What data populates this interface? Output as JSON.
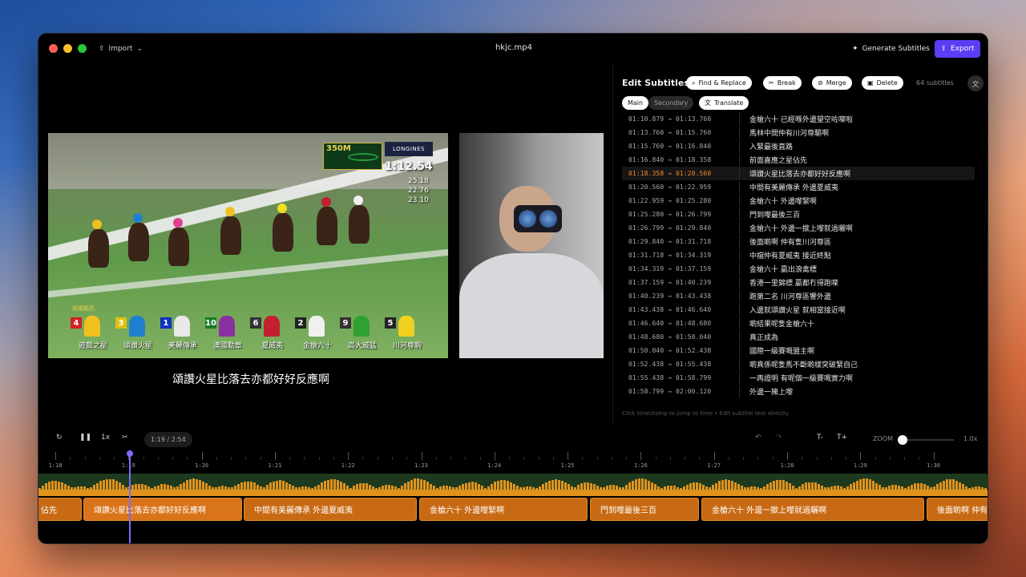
{
  "window": {
    "title": "hkjc.mp4",
    "import_label": "Import",
    "generate_label": "Generate Subtitles",
    "export_label": "Export"
  },
  "video": {
    "distance_badge": "350M",
    "sponsor": "LONGINES",
    "race_time": "1:12.54",
    "splits": [
      "25.18",
      "22.76",
      "23.10"
    ],
    "leader_label": "前領馬匹",
    "runners": [
      {
        "number": "4",
        "name": "遊戲之星",
        "num_color": "#d42020",
        "silk_color": "#f0c020"
      },
      {
        "number": "3",
        "name": "頌讚火星",
        "num_color": "#e0c010",
        "silk_color": "#2080d0"
      },
      {
        "number": "1",
        "name": "美麗傳承",
        "num_color": "#1030c0",
        "silk_color": "#e8e8e8"
      },
      {
        "number": "10",
        "name": "澳國勳章",
        "num_color": "#1a7a2a",
        "silk_color": "#8a30a0"
      },
      {
        "number": "6",
        "name": "夏威夷",
        "num_color": "#333333",
        "silk_color": "#c02030"
      },
      {
        "number": "2",
        "name": "金槍六十",
        "num_color": "#222222",
        "silk_color": "#f0f0f0"
      },
      {
        "number": "9",
        "name": "高大威猛",
        "num_color": "#333333",
        "silk_color": "#30a030"
      },
      {
        "number": "5",
        "name": "川河尊駒",
        "num_color": "#222222",
        "silk_color": "#f0d020"
      }
    ],
    "subtitle": "頌讚火星比落去亦都好好反應啊"
  },
  "editor": {
    "title": "Edit Subtitles",
    "find_replace_label": "Find & Replace",
    "break_label": "Break",
    "merge_label": "Merge",
    "delete_label": "Delete",
    "count_label": "64 subtitles",
    "main_label": "Main",
    "secondary_label": "Secondary",
    "translate_label": "Translate",
    "hint": "Click timestamp to jump to time • Edit subtitle text directly",
    "subtitles": [
      {
        "time": "01:10.879 → 01:13.760",
        "text": "金槍六十  已經喺外邊望空咗㗎啦"
      },
      {
        "time": "01:13.760 → 01:15.760",
        "text": "馬林中間仲有川河尊驅啊"
      },
      {
        "time": "01:15.760 → 01:16.840",
        "text": "入緊最後直路"
      },
      {
        "time": "01:16.840 → 01:18.358",
        "text": "前面嘉應之星佔先"
      },
      {
        "time": "01:18.358 → 01:20.560",
        "text": "頌讚火星比落去亦都好好反應啊",
        "active": true
      },
      {
        "time": "01:20.560 → 01:22.959",
        "text": "中間有美麗傳承  外邊夏威夷"
      },
      {
        "time": "01:22.959 → 01:25.280",
        "text": "金槍六十  外邊嚟緊啊"
      },
      {
        "time": "01:25.280 → 01:26.799",
        "text": "門到嚟最後三百"
      },
      {
        "time": "01:26.799 → 01:29.840",
        "text": "金槍六十  外邊一撳上嚟就過曬啊"
      },
      {
        "time": "01:29.840 → 01:31.718",
        "text": "後面啲啊  仲有隻川河尊區"
      },
      {
        "time": "01:31.718 → 01:34.319",
        "text": "中檔仲有夏威夷  接近終點"
      },
      {
        "time": "01:34.319 → 01:37.159",
        "text": "金槍六十  贏出浪禽標"
      },
      {
        "time": "01:37.159 → 01:40.239",
        "text": "香港一里錦標  贏都冇得跑㗎"
      },
      {
        "time": "01:40.239 → 01:43.438",
        "text": "跑第二名  川河尊區響外邊"
      },
      {
        "time": "01:43.438 → 01:46.640",
        "text": "入邊就頌讚火星  就相當接近啊"
      },
      {
        "time": "01:46.640 → 01:48.680",
        "text": "啲結果呢隻金槍六十"
      },
      {
        "time": "01:48.680 → 01:50.040",
        "text": "真正成為"
      },
      {
        "time": "01:50.040 → 01:52.438",
        "text": "國際一級賽嘅盟主啊"
      },
      {
        "time": "01:52.438 → 01:55.438",
        "text": "啲真係呢隻馬不斷啲樣突破緊自己"
      },
      {
        "time": "01:55.438 → 01:58.799",
        "text": "一再證明  有呢個一級賽嘅實力啊"
      },
      {
        "time": "01:58.799 → 02:00.120",
        "text": "外邊一擁上嚟"
      }
    ]
  },
  "controls": {
    "speed_label": "1x",
    "time_display": "1:19 / 2:54",
    "text_smaller": "T-",
    "text_larger": "T+",
    "zoom_label": "ZOOM",
    "zoom_value": "1.0x",
    "zoom_level": 0.0
  },
  "timeline": {
    "ticks": [
      "1:18",
      "1:19",
      "1:20",
      "1:21",
      "1:22",
      "1:23",
      "1:24",
      "1:25",
      "1:26",
      "1:27",
      "1:28",
      "1:29",
      "1:30"
    ],
    "blocks": [
      {
        "text": "佔先"
      },
      {
        "text": "頌讚火星比落去亦都好好反應啊",
        "selected": true
      },
      {
        "text": "中間有美麗傳承 外邊夏威夷"
      },
      {
        "text": "金槍六十 外邊嚟緊啊"
      },
      {
        "text": "門到嚟最後三百"
      },
      {
        "text": "金槍六十 外邊一撳上嚟就過曬啊"
      },
      {
        "text": "後面啲啊 仲有"
      }
    ]
  },
  "colors": {
    "accent": "#5b3df5",
    "active_time": "#f08a2a",
    "subtitle_block": "#c86a14",
    "waveform": "#e0921e"
  }
}
